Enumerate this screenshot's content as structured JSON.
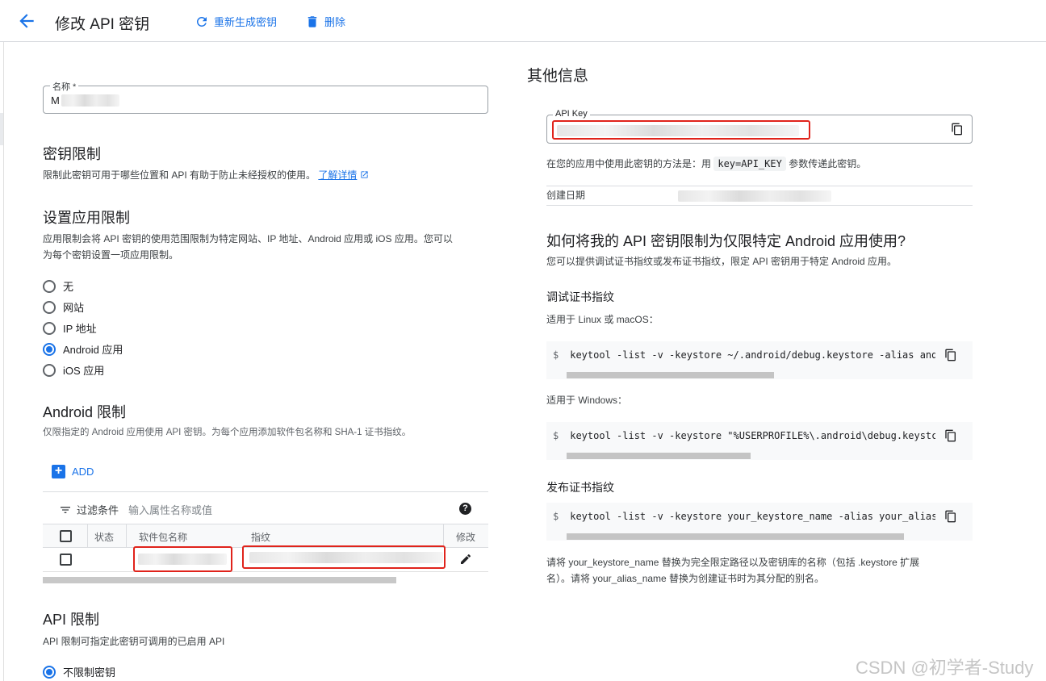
{
  "header": {
    "title": "修改 API 密钥",
    "regenerate_label": "重新生成密钥",
    "delete_label": "删除"
  },
  "name_field": {
    "label": "名称 *",
    "value_prefix": "M"
  },
  "key_restrictions": {
    "heading": "密钥限制",
    "description": "限制此密钥可用于哪些位置和 API 有助于防止未经授权的使用。",
    "learn_more": "了解详情"
  },
  "app_restrictions": {
    "heading": "设置应用限制",
    "description_line1": "应用限制会将 API 密钥的使用范围限制为特定网站、IP 地址、Android 应用或 iOS 应用。您可以",
    "description_line2": "为每个密钥设置一项应用限制。",
    "options": [
      "无",
      "网站",
      "IP 地址",
      "Android 应用",
      "iOS 应用"
    ],
    "selected": "Android 应用"
  },
  "android_restrictions": {
    "heading": "Android 限制",
    "description": "仅限指定的 Android 应用使用 API 密钥。为每个应用添加软件包名称和 SHA-1 证书指纹。",
    "add_label": "ADD",
    "filter_label": "过滤条件",
    "filter_placeholder": "输入属性名称或值",
    "columns": [
      "状态",
      "软件包名称",
      "指纹",
      "修改"
    ]
  },
  "api_restrictions": {
    "heading": "API 限制",
    "description": "API 限制可指定此密钥可调用的已启用 API",
    "option": "不限制密钥"
  },
  "other_info": {
    "heading": "其他信息",
    "api_key_label": "API Key",
    "usage_prefix": "在您的应用中使用此密钥的方法是：用",
    "usage_code": "key=API_KEY",
    "usage_suffix": "参数传递此密钥。",
    "created_label": "创建日期"
  },
  "android_howto": {
    "heading": "如何将我的 API 密钥限制为仅限特定 Android 应用使用?",
    "description": "您可以提供调试证书指纹或发布证书指纹，限定 API 密钥用于特定 Android 应用。",
    "debug_heading": "调试证书指纹",
    "linux_label": "适用于 Linux 或 macOS：",
    "linux_cmd": "keytool -list -v -keystore ~/.android/debug.keystore -alias and",
    "windows_label": "适用于 Windows：",
    "windows_cmd": "keytool -list -v -keystore \"%USERPROFILE%\\.android\\debug.keystc",
    "release_heading": "发布证书指纹",
    "release_cmd": "keytool -list -v -keystore your_keystore_name -alias your_alias",
    "dollar": "$",
    "note_line1": "请将 your_keystore_name 替换为完全限定路径以及密钥库的名称（包括 .keystore 扩展",
    "note_line2": "名）。请将 your_alias_name 替换为创建证书时为其分配的别名。"
  },
  "watermark": "CSDN @初学者-Study",
  "colors": {
    "accent": "#1a73e8",
    "highlight_box": "#e0231b"
  }
}
